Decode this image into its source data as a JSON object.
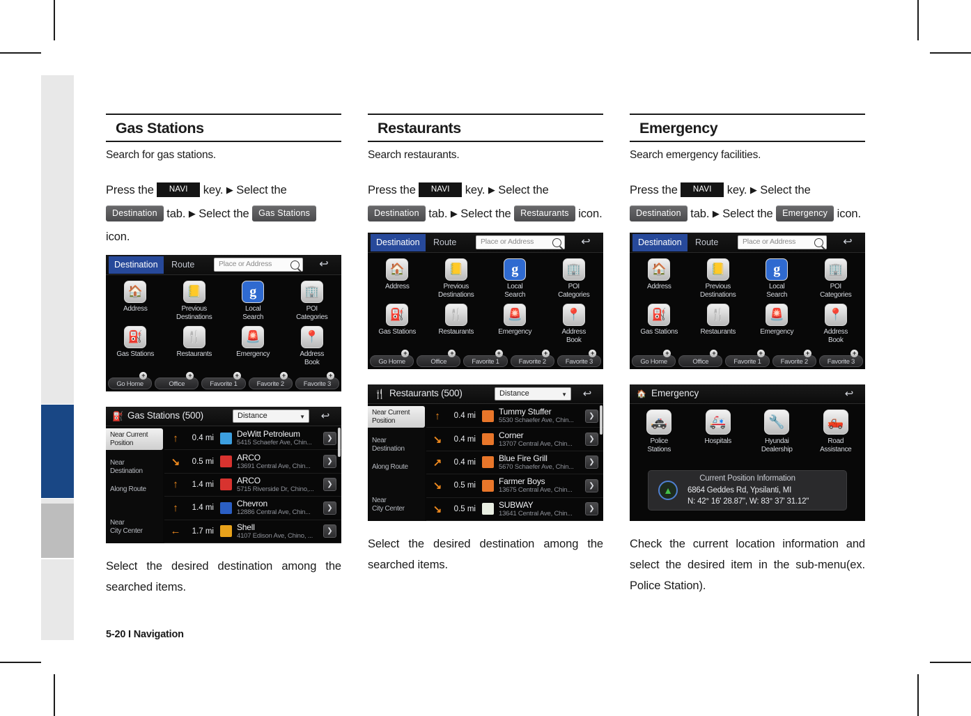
{
  "footer": {
    "text": "5-20 I Navigation"
  },
  "columns": [
    {
      "heading": "Gas Stations",
      "description": "Search for gas stations.",
      "instruction": {
        "press_the": "Press the",
        "navi_key": "NAVI",
        "key_word": "key.",
        "arrow": "▶",
        "select_the": "Select the",
        "tab_chip": "Destination",
        "tab_word": "tab.",
        "arrow2": "▶",
        "select_the2": "Select the",
        "icon_chip": "Gas Stations",
        "icon_word": "icon."
      },
      "caption": "Select the desired destination among the searched items.",
      "screens": {
        "home": {
          "tabs": [
            {
              "label": "Destination",
              "active": true
            },
            {
              "label": "Route",
              "active": false
            }
          ],
          "search_placeholder": "Place or Address",
          "search_icon": "search-icon",
          "back_icon": "↩",
          "menu": [
            {
              "label": "Address",
              "icon": "🏠",
              "blue": false
            },
            {
              "label": "Previous\nDestinations",
              "icon": "📒",
              "blue": false
            },
            {
              "label": "Local\nSearch",
              "icon": "g",
              "blue": true
            },
            {
              "label": "POI\nCategories",
              "icon": "🏢",
              "blue": false
            },
            {
              "label": "Gas Stations",
              "icon": "⛽",
              "blue": false
            },
            {
              "label": "Restaurants",
              "icon": "🍴",
              "blue": false
            },
            {
              "label": "Emergency",
              "icon": "🚨",
              "blue": false
            },
            {
              "label": "Address\nBook",
              "icon": "📍",
              "blue": false
            }
          ],
          "favorites": [
            "Go Home",
            "Office",
            "Favorite 1",
            "Favorite 2",
            "Favorite 3"
          ],
          "plus_glyph": "+"
        },
        "list": {
          "title": "Gas Stations (500)",
          "title_icon": "⛽",
          "sort_value": "Distance",
          "back_icon": "↩",
          "side_items": [
            {
              "label": "Near Current\nPosition",
              "active": true
            },
            {
              "label": "Near\nDestination",
              "active": false
            },
            {
              "label": "Along Route",
              "active": false
            },
            {
              "label": "Near\nCity Center",
              "active": false
            }
          ],
          "rows": [
            {
              "arrow": "↑",
              "distance": "0.4 mi",
              "name": "DeWitt Petroleum",
              "address": "5415 Schaefer Ave, Chin...",
              "brand_color": "#3c9fe0",
              "chevron": "❯"
            },
            {
              "arrow": "↘",
              "distance": "0.5 mi",
              "name": "ARCO",
              "address": "13691 Central Ave, Chin...",
              "brand_color": "#d8332f",
              "chevron": "❯"
            },
            {
              "arrow": "↑",
              "distance": "1.4 mi",
              "name": "ARCO",
              "address": "5715 Riverside Dr, Chino,...",
              "brand_color": "#d8332f",
              "chevron": "❯"
            },
            {
              "arrow": "↑",
              "distance": "1.4 mi",
              "name": "Chevron",
              "address": "12886 Central Ave, Chin...",
              "brand_color": "#2b5fc4",
              "chevron": "❯"
            },
            {
              "arrow": "←",
              "distance": "1.7 mi",
              "name": "Shell",
              "address": "4107 Edison Ave, Chino, ...",
              "brand_color": "#e8a21b",
              "chevron": "❯"
            }
          ]
        }
      }
    },
    {
      "heading": "Restaurants",
      "description": "Search restaurants.",
      "instruction": {
        "press_the": "Press the",
        "navi_key": "NAVI",
        "key_word": "key.",
        "arrow": "▶",
        "select_the": "Select the",
        "tab_chip": "Destination",
        "tab_word": "tab.",
        "arrow2": "▶",
        "select_the2": "Select the",
        "icon_chip": "Restaurants",
        "icon_word": "icon."
      },
      "caption": "Select the desired destination among the searched items.",
      "screens": {
        "home": {
          "tabs": [
            {
              "label": "Destination",
              "active": true
            },
            {
              "label": "Route",
              "active": false
            }
          ],
          "search_placeholder": "Place or Address",
          "search_icon": "search-icon",
          "back_icon": "↩",
          "menu": [
            {
              "label": "Address",
              "icon": "🏠",
              "blue": false
            },
            {
              "label": "Previous\nDestinations",
              "icon": "📒",
              "blue": false
            },
            {
              "label": "Local\nSearch",
              "icon": "g",
              "blue": true
            },
            {
              "label": "POI\nCategories",
              "icon": "🏢",
              "blue": false
            },
            {
              "label": "Gas Stations",
              "icon": "⛽",
              "blue": false
            },
            {
              "label": "Restaurants",
              "icon": "🍴",
              "blue": false
            },
            {
              "label": "Emergency",
              "icon": "🚨",
              "blue": false
            },
            {
              "label": "Address\nBook",
              "icon": "📍",
              "blue": false
            }
          ],
          "favorites": [
            "Go Home",
            "Office",
            "Favorite 1",
            "Favorite 2",
            "Favorite 3"
          ],
          "plus_glyph": "+"
        },
        "list": {
          "title": "Restaurants (500)",
          "title_icon": "🍴",
          "sort_value": "Distance",
          "back_icon": "↩",
          "side_items": [
            {
              "label": "Near Current\nPosition",
              "active": true
            },
            {
              "label": "Near\nDestination",
              "active": false
            },
            {
              "label": "Along Route",
              "active": false
            },
            {
              "label": "Near\nCity Center",
              "active": false
            }
          ],
          "rows": [
            {
              "arrow": "↑",
              "distance": "0.4 mi",
              "name": "Tummy Stuffer",
              "address": "5530 Schaefer Ave, Chin...",
              "brand_color": "#e8762a",
              "chevron": "❯"
            },
            {
              "arrow": "↘",
              "distance": "0.4 mi",
              "name": "Corner",
              "address": "13707 Central Ave, Chin...",
              "brand_color": "#e8762a",
              "chevron": "❯"
            },
            {
              "arrow": "↗",
              "distance": "0.4 mi",
              "name": "Blue Fire Grill",
              "address": "5670 Schaefer Ave, Chin...",
              "brand_color": "#e8762a",
              "chevron": "❯"
            },
            {
              "arrow": "↘",
              "distance": "0.5 mi",
              "name": "Farmer Boys",
              "address": "13675 Central Ave, Chin...",
              "brand_color": "#e8762a",
              "chevron": "❯"
            },
            {
              "arrow": "↘",
              "distance": "0.5 mi",
              "name": "SUBWAY",
              "address": "13641 Central Ave, Chin...",
              "brand_color": "#e9eee2",
              "chevron": "❯"
            }
          ]
        }
      }
    },
    {
      "heading": "Emergency",
      "description": "Search emergency facilities.",
      "instruction": {
        "press_the": "Press the",
        "navi_key": "NAVI",
        "key_word": "key.",
        "arrow": "▶",
        "select_the": "Select the",
        "tab_chip": "Destination",
        "tab_word": "tab.",
        "arrow2": "▶",
        "select_the2": "Select the",
        "icon_chip": "Emergency",
        "icon_word": "icon."
      },
      "caption": "Check the current location information and select the desired item in the sub-menu(ex. Police Station).",
      "screens": {
        "home": {
          "tabs": [
            {
              "label": "Destination",
              "active": true
            },
            {
              "label": "Route",
              "active": false
            }
          ],
          "search_placeholder": "Place or Address",
          "search_icon": "search-icon",
          "back_icon": "↩",
          "menu": [
            {
              "label": "Address",
              "icon": "🏠",
              "blue": false
            },
            {
              "label": "Previous\nDestinations",
              "icon": "📒",
              "blue": false
            },
            {
              "label": "Local\nSearch",
              "icon": "g",
              "blue": true
            },
            {
              "label": "POI\nCategories",
              "icon": "🏢",
              "blue": false
            },
            {
              "label": "Gas Stations",
              "icon": "⛽",
              "blue": false
            },
            {
              "label": "Restaurants",
              "icon": "🍴",
              "blue": false
            },
            {
              "label": "Emergency",
              "icon": "🚨",
              "blue": false
            },
            {
              "label": "Address\nBook",
              "icon": "📍",
              "blue": false
            }
          ],
          "favorites": [
            "Go Home",
            "Office",
            "Favorite 1",
            "Favorite 2",
            "Favorite 3"
          ],
          "plus_glyph": "+"
        },
        "emergency": {
          "title": "Emergency",
          "title_icon": "🏠",
          "back_icon": "↩",
          "menu": [
            {
              "label": "Police\nStations",
              "icon": "🚓"
            },
            {
              "label": "Hospitals",
              "icon": "🚑"
            },
            {
              "label": "Hyundai\nDealership",
              "icon": "🔧"
            },
            {
              "label": "Road\nAssistance",
              "icon": "🛻"
            }
          ],
          "panel": {
            "title": "Current Position Information",
            "address": "6864 Geddes Rd, Ypsilanti, MI",
            "coords": "N: 42° 16' 28.87\", W: 83° 37' 31.12\"",
            "compass_icon": "▲"
          }
        }
      }
    }
  ],
  "colors": {
    "accent_blue": "#194785",
    "tab_blue": "#27499a",
    "sidebar_gray": "#bdbdbd",
    "sidebar_light": "#e8e8e8",
    "arrow_orange": "#f08a1e"
  }
}
